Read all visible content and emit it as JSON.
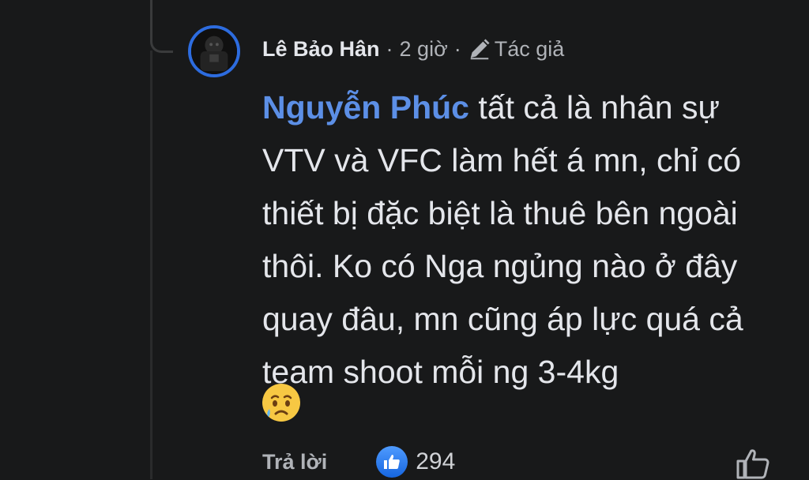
{
  "comment": {
    "author": "Lê Bảo Hân",
    "separator": "·",
    "time": "2 giờ",
    "author_badge": "Tác giả",
    "mention": "Nguyễn Phúc",
    "text": " tất cả là nhân sự VTV và VFC làm hết á mn, chỉ có thiết bị đặc biệt là thuê bên ngoài thôi. Ko có Nga ngủng nào ở đây quay đâu, mn cũng áp lực quá cả team shoot mỗi ng 3-4kg",
    "emoji": "sad-tear-face",
    "reply_label": "Trả lời",
    "reaction_count": "294"
  },
  "colors": {
    "background": "#18191a",
    "text": "#e4e6eb",
    "secondary_text": "#b0b3b8",
    "mention": "#5c8fe6",
    "like_blue": "#1877f2",
    "avatar_ring": "#2d6cdf"
  },
  "icons": {
    "badge": "pencil-icon",
    "reaction": "thumbs-up-icon",
    "like_button": "thumbs-up-outline-icon"
  }
}
